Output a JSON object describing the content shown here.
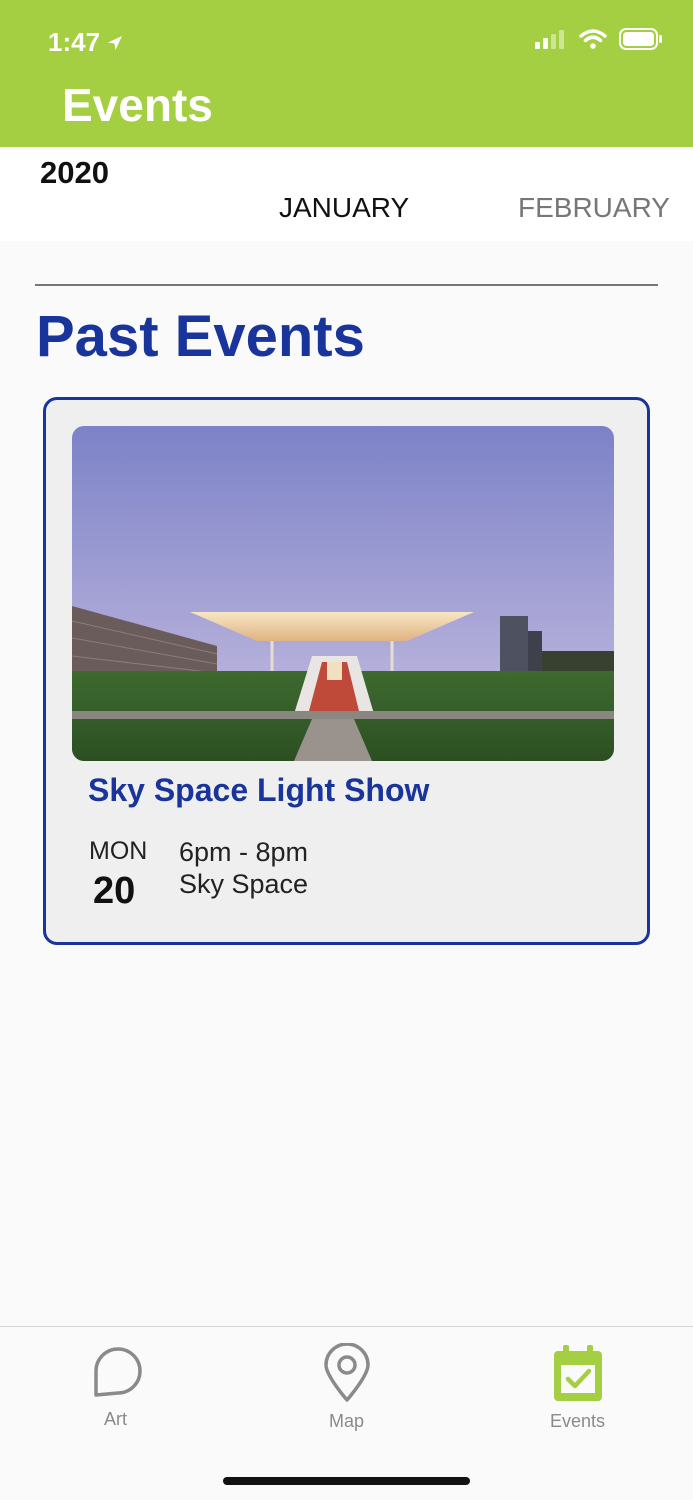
{
  "status_bar": {
    "time": "1:47"
  },
  "header": {
    "title": "Events",
    "background": "#a5cf42"
  },
  "calendar": {
    "year": "2020",
    "months": [
      "JANUARY",
      "FEBRUARY"
    ],
    "selected_month": "JANUARY"
  },
  "section": {
    "title": "Past Events"
  },
  "event": {
    "title": "Sky Space Light Show",
    "day_name": "MON",
    "day_number": "20",
    "time": "6pm - 8pm",
    "location": "Sky Space"
  },
  "tabbar": {
    "tabs": [
      {
        "label": "Art",
        "icon": "speech-bubble-icon"
      },
      {
        "label": "Map",
        "icon": "map-pin-icon"
      },
      {
        "label": "Events",
        "icon": "calendar-check-icon"
      }
    ],
    "active": "Events",
    "active_color": "#a5cf42"
  }
}
